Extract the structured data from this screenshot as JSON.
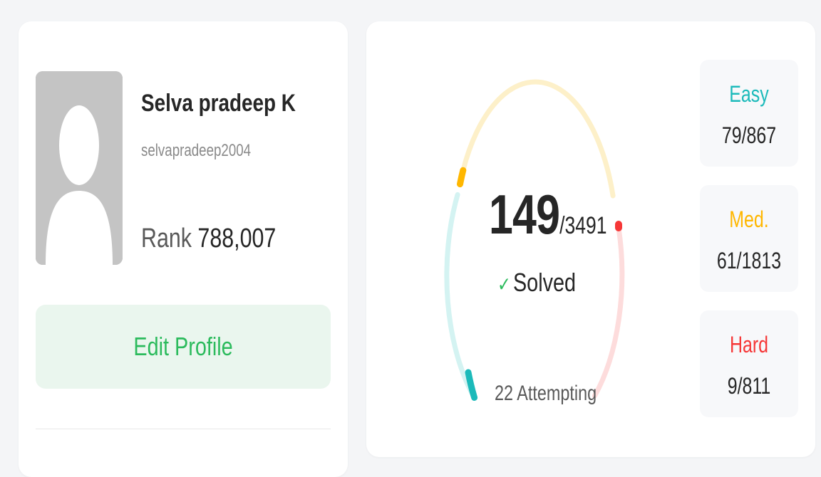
{
  "profile": {
    "name": "Selva pradeep K",
    "username": "selvapradeep2004",
    "rank_label": "Rank",
    "rank_value": "788,007",
    "edit_button_label": "Edit Profile",
    "avatar_icon": "default-avatar-icon"
  },
  "stats": {
    "solved_count": "149",
    "total_questions": "/3491",
    "solved_label": "Solved",
    "check_icon": "✓",
    "attempting_text": "22 Attempting",
    "difficulties": [
      {
        "name": "Easy",
        "value": "79/867",
        "color": "#1cbaba"
      },
      {
        "name": "Med.",
        "value": "61/1813",
        "color": "#ffb700"
      },
      {
        "name": "Hard",
        "value": "9/811",
        "color": "#f63737"
      }
    ]
  },
  "colors": {
    "accent_green": "#2cbb5d",
    "easy": "#1cbaba",
    "medium": "#ffb700",
    "hard": "#f63737"
  }
}
